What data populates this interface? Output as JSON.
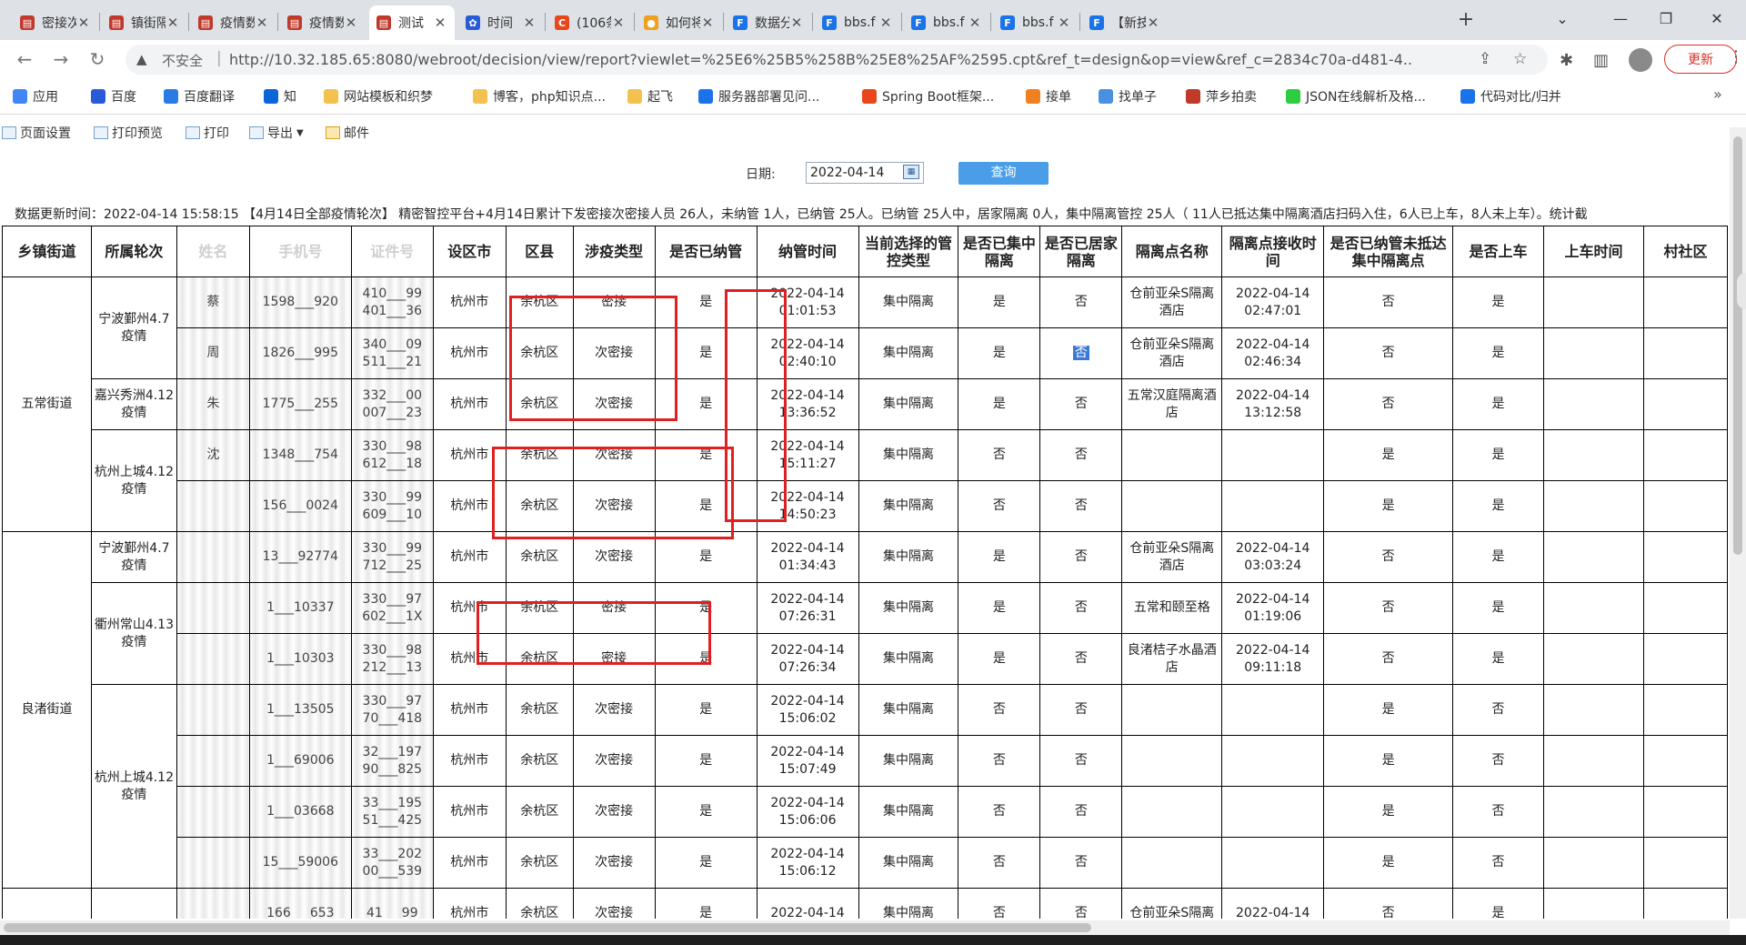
{
  "browser": {
    "tabs": [
      {
        "label": "密接次",
        "color": "#c0392b",
        "icon": "page-icon"
      },
      {
        "label": "镇街隔",
        "color": "#c0392b",
        "icon": "page-icon"
      },
      {
        "label": "疫情数",
        "color": "#c0392b",
        "icon": "page-icon"
      },
      {
        "label": "疫情数",
        "color": "#c0392b",
        "icon": "page-icon"
      },
      {
        "label": "测试",
        "color": "#c0392b",
        "icon": "page-icon"
      },
      {
        "label": "时间",
        "color": "#2a5bd7",
        "icon": "paw-icon"
      },
      {
        "label": "(106条",
        "color": "#e8461d",
        "icon": "c-icon"
      },
      {
        "label": "如何将",
        "color": "#f0a020",
        "icon": "circle-icon"
      },
      {
        "label": "数据分",
        "color": "#1a73e8",
        "icon": "f-icon"
      },
      {
        "label": "bbs.f",
        "color": "#1a73e8",
        "icon": "f-icon"
      },
      {
        "label": "bbs.f",
        "color": "#1a73e8",
        "icon": "f-icon"
      },
      {
        "label": "bbs.f",
        "color": "#1a73e8",
        "icon": "f-icon"
      },
      {
        "label": "【新技",
        "color": "#1a73e8",
        "icon": "f-icon"
      }
    ],
    "active_tab": 4,
    "new_tab": "+",
    "insecure_label": "不安全",
    "url": "http://10.32.185.65:8080/webroot/decision/view/report?viewlet=%25E6%25B5%258B%25E8%25AF%2595.cpt&ref_t=design&op=view&ref_c=2834c70a-d481-4...",
    "update_label": "更新"
  },
  "bookmarks": [
    {
      "label": "应用",
      "color": "#4285f4"
    },
    {
      "label": "百度",
      "color": "#2a5bd7"
    },
    {
      "label": "百度翻译",
      "color": "#2a7be4"
    },
    {
      "label": "知",
      "color": "#0a66d8"
    },
    {
      "label": "网站模板和织梦",
      "color": "#f2c14e"
    },
    {
      "label": "博客，php知识点...",
      "color": "#f2c14e"
    },
    {
      "label": "起飞",
      "color": "#f2c14e"
    },
    {
      "label": "服务器部署见问...",
      "color": "#1a73e8"
    },
    {
      "label": "Spring Boot框架...",
      "color": "#e8461d"
    },
    {
      "label": "接单",
      "color": "#f08020"
    },
    {
      "label": "找单子",
      "color": "#4a90e2"
    },
    {
      "label": "萍乡拍卖",
      "color": "#c0392b"
    },
    {
      "label": "JSON在线解析及格...",
      "color": "#2ecc40"
    },
    {
      "label": "代码对比/归并",
      "color": "#1a73e8"
    }
  ],
  "report_toolbar": [
    "页面设置",
    "打印预览",
    "打印",
    "导出",
    "邮件"
  ],
  "query": {
    "date_label": "日期:",
    "date_value": "2022-04-14",
    "query_button": "查询"
  },
  "status_text": "数据更新时间：2022-04-14 15:58:15        【4月14日全部疫情轮次】 精密智控平台+4月14日累计下发密接次密接人员 26人，未纳管 1人，已纳管 25人。已纳管 25人中，居家隔离 0人，集中隔离管控 25人（ 11人已抵达集中隔离酒店扫码入住，6人已上车，8人未上车）。统计截",
  "table": {
    "headers": [
      "乡镇街道",
      "所属轮次",
      "姓名",
      "手机号",
      "证件号",
      "设区市",
      "区县",
      "涉疫类型",
      "是否已纳管",
      "纳管时间",
      "当前选择的管控类型",
      "是否已集中隔离",
      "是否已居家隔离",
      "隔离点名称",
      "隔离点接收时间",
      "是否已纳管未抵达集中隔离点",
      "是否上车",
      "上车时间",
      "村社区"
    ],
    "masked_headers": [
      2,
      3,
      4
    ],
    "groups": [
      {
        "street": "五常街道",
        "rowspan": 5
      },
      {
        "street": "良渚街道",
        "rowspan": 7
      }
    ],
    "rounds": [
      {
        "label": "宁波鄞州4.7疫情",
        "rowspan": 2
      },
      {
        "label": "嘉兴秀洲4.12疫情",
        "rowspan": 1
      },
      {
        "label": "杭州上城4.12疫情",
        "rowspan": 2
      },
      {
        "label": "宁波鄞州4.7疫情",
        "rowspan": 1
      },
      {
        "label": "衢州常山4.13疫情",
        "rowspan": 2
      },
      {
        "label": "杭州上城4.12疫情",
        "rowspan": 4
      },
      {
        "label": "",
        "rowspan": 1
      }
    ],
    "rows": [
      {
        "name": "蔡",
        "phone": "1598___920",
        "id": "410___99 401___36",
        "city": "杭州市",
        "district": "余杭区",
        "type": "密接",
        "managed": "是",
        "time": "2022-04-14 01:01:53",
        "ctrl": "集中隔离",
        "central": "是",
        "home": "否",
        "site": "仓前亚朵S隔离酒店",
        "recv": "2022-04-14 02:47:01",
        "notarrived": "否",
        "bus": "是",
        "bustime": "",
        "village": ""
      },
      {
        "name": "周",
        "phone": "1826___995",
        "id": "340___09 511___21",
        "city": "杭州市",
        "district": "余杭区",
        "type": "次密接",
        "managed": "是",
        "time": "2022-04-14 02:40:10",
        "ctrl": "集中隔离",
        "central": "是",
        "home": "否",
        "site": "仓前亚朵S隔离酒店",
        "recv": "2022-04-14 02:46:34",
        "notarrived": "否",
        "bus": "是",
        "bustime": "",
        "village": ""
      },
      {
        "name": "朱",
        "phone": "1775___255",
        "id": "332___00 007___23",
        "city": "杭州市",
        "district": "余杭区",
        "type": "次密接",
        "managed": "是",
        "time": "2022-04-14 13:36:52",
        "ctrl": "集中隔离",
        "central": "是",
        "home": "否",
        "site": "五常汉庭隔离酒店",
        "recv": "2022-04-14 13:12:58",
        "notarrived": "否",
        "bus": "是",
        "bustime": "",
        "village": ""
      },
      {
        "name": "沈",
        "phone": "1348___754",
        "id": "330___98 612___18",
        "city": "杭州市",
        "district": "余杭区",
        "type": "次密接",
        "managed": "是",
        "time": "2022-04-14 15:11:27",
        "ctrl": "集中隔离",
        "central": "否",
        "home": "否",
        "site": "",
        "recv": "",
        "notarrived": "是",
        "bus": "是",
        "bustime": "",
        "village": ""
      },
      {
        "name": "",
        "phone": "156___0024",
        "id": "330___99 609___10",
        "city": "杭州市",
        "district": "余杭区",
        "type": "次密接",
        "managed": "是",
        "time": "2022-04-14 14:50:23",
        "ctrl": "集中隔离",
        "central": "否",
        "home": "否",
        "site": "",
        "recv": "",
        "notarrived": "是",
        "bus": "是",
        "bustime": "",
        "village": ""
      },
      {
        "name": "",
        "phone": "13___92774",
        "id": "330___99 712___25",
        "city": "杭州市",
        "district": "余杭区",
        "type": "次密接",
        "managed": "是",
        "time": "2022-04-14 01:34:43",
        "ctrl": "集中隔离",
        "central": "是",
        "home": "否",
        "site": "仓前亚朵S隔离酒店",
        "recv": "2022-04-14 03:03:24",
        "notarrived": "否",
        "bus": "是",
        "bustime": "",
        "village": ""
      },
      {
        "name": "",
        "phone": "1___10337",
        "id": "330___97 602___1X",
        "city": "杭州市",
        "district": "余杭区",
        "type": "密接",
        "managed": "是",
        "time": "2022-04-14 07:26:31",
        "ctrl": "集中隔离",
        "central": "是",
        "home": "否",
        "site": "五常和颐至格",
        "recv": "2022-04-14 01:19:06",
        "notarrived": "否",
        "bus": "是",
        "bustime": "",
        "village": ""
      },
      {
        "name": "",
        "phone": "1___10303",
        "id": "330___98 212___13",
        "city": "杭州市",
        "district": "余杭区",
        "type": "密接",
        "managed": "是",
        "time": "2022-04-14 07:26:34",
        "ctrl": "集中隔离",
        "central": "是",
        "home": "否",
        "site": "良渚桔子水晶酒店",
        "recv": "2022-04-14 09:11:18",
        "notarrived": "否",
        "bus": "是",
        "bustime": "",
        "village": ""
      },
      {
        "name": "",
        "phone": "1___13505",
        "id": "330___97 70___418",
        "city": "杭州市",
        "district": "余杭区",
        "type": "次密接",
        "managed": "是",
        "time": "2022-04-14 15:06:02",
        "ctrl": "集中隔离",
        "central": "否",
        "home": "否",
        "site": "",
        "recv": "",
        "notarrived": "是",
        "bus": "否",
        "bustime": "",
        "village": ""
      },
      {
        "name": "",
        "phone": "1___69006",
        "id": "32___197 90___825",
        "city": "杭州市",
        "district": "余杭区",
        "type": "次密接",
        "managed": "是",
        "time": "2022-04-14 15:07:49",
        "ctrl": "集中隔离",
        "central": "否",
        "home": "否",
        "site": "",
        "recv": "",
        "notarrived": "是",
        "bus": "否",
        "bustime": "",
        "village": ""
      },
      {
        "name": "",
        "phone": "1___03668",
        "id": "33___195 51___425",
        "city": "杭州市",
        "district": "余杭区",
        "type": "次密接",
        "managed": "是",
        "time": "2022-04-14 15:06:06",
        "ctrl": "集中隔离",
        "central": "否",
        "home": "否",
        "site": "",
        "recv": "",
        "notarrived": "是",
        "bus": "否",
        "bustime": "",
        "village": ""
      },
      {
        "name": "",
        "phone": "15___59006",
        "id": "33___202 00___539",
        "city": "杭州市",
        "district": "余杭区",
        "type": "次密接",
        "managed": "是",
        "time": "2022-04-14 15:06:12",
        "ctrl": "集中隔离",
        "central": "否",
        "home": "否",
        "site": "",
        "recv": "",
        "notarrived": "是",
        "bus": "否",
        "bustime": "",
        "village": ""
      },
      {
        "name": "",
        "phone": "166___653",
        "id": "41___99",
        "city": "杭州市",
        "district": "余杭区",
        "type": "次密接",
        "managed": "是",
        "time": "2022-04-14",
        "ctrl": "集中隔离",
        "central": "否",
        "home": "否",
        "site": "仓前亚朵S隔离",
        "recv": "2022-04-14",
        "notarrived": "否",
        "bus": "是",
        "bustime": "",
        "village": ""
      }
    ],
    "highlight": {
      "row": 1,
      "field": "home"
    }
  },
  "annotation_color": "#e02020"
}
